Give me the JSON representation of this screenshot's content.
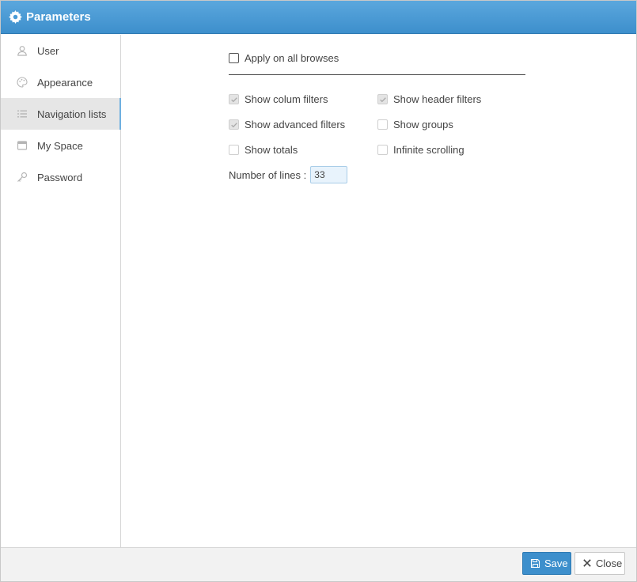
{
  "window": {
    "title": "Parameters",
    "title_icon": "gear-icon"
  },
  "sidebar": {
    "items": [
      {
        "label": "User",
        "icon": "user-icon",
        "active": false
      },
      {
        "label": "Appearance",
        "icon": "palette-icon",
        "active": false
      },
      {
        "label": "Navigation lists",
        "icon": "list-icon",
        "active": true
      },
      {
        "label": "My Space",
        "icon": "window-icon",
        "active": false
      },
      {
        "label": "Password",
        "icon": "key-icon",
        "active": false
      }
    ]
  },
  "settings": {
    "apply_all": {
      "label": "Apply on all browses",
      "checked": false
    },
    "options": [
      {
        "label": "Show colum filters",
        "checked": true
      },
      {
        "label": "Show header filters",
        "checked": true
      },
      {
        "label": "Show advanced filters",
        "checked": true
      },
      {
        "label": "Show groups",
        "checked": false
      },
      {
        "label": "Show totals",
        "checked": false
      },
      {
        "label": "Infinite scrolling",
        "checked": false
      }
    ],
    "lines": {
      "label": "Number of lines :",
      "value": "33"
    }
  },
  "footer": {
    "save_label": "Save",
    "close_label": "Close"
  },
  "colors": {
    "accent": "#3d8fcc",
    "titlebar": "#4a9bd6"
  }
}
